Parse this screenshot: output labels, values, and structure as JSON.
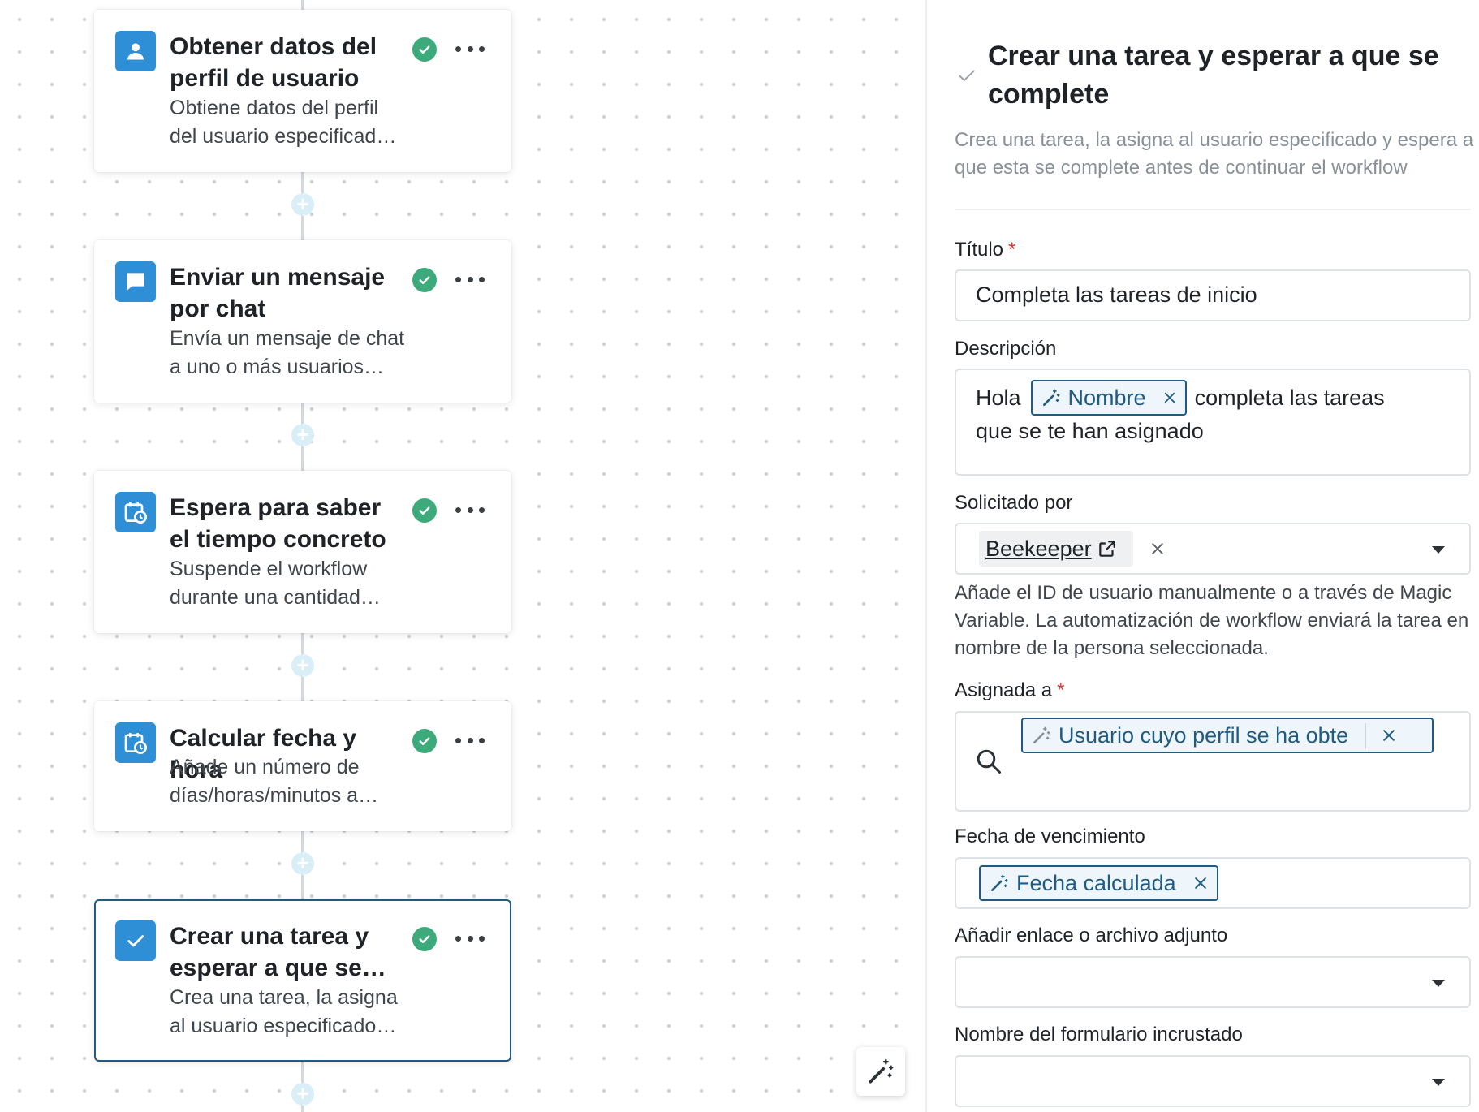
{
  "workflow": {
    "steps": [
      {
        "icon": "user-icon",
        "title": "Obtener datos del perfil de usuario",
        "description_line1": "Obtiene datos del perfil",
        "description_line2": "del usuario especificad…",
        "status": "completed"
      },
      {
        "icon": "chat-icon",
        "title": "Enviar un mensaje por chat",
        "description_line1": "Envía un mensaje de chat",
        "description_line2": "a uno o más usuarios…",
        "status": "completed"
      },
      {
        "icon": "calendar-clock-icon",
        "title": "Espera para saber el tiempo concreto",
        "description_line1": "Suspende el workflow",
        "description_line2": "durante una cantidad…",
        "status": "completed"
      },
      {
        "icon": "calendar-clock-icon",
        "title": "Calcular fecha y hora",
        "description_line1": "Añade un número de",
        "description_line2": "días/horas/minutos a…",
        "status": "completed"
      },
      {
        "icon": "task-check-icon",
        "title": "Crear una tarea y esperar a que se…",
        "description_line1": "Crea una tarea, la asigna",
        "description_line2": "al usuario especificado…",
        "status": "completed",
        "selected": true
      }
    ]
  },
  "panel": {
    "title": "Crear una tarea y esperar a que se complete",
    "description": "Crea una tarea, la asigna al usuario especificado y espera a que esta se complete antes de continuar el workflow",
    "fields": {
      "titulo": {
        "label": "Título",
        "required": "*",
        "value": "Completa las tareas de inicio"
      },
      "descripcion": {
        "label": "Descripción",
        "text_before": "Hola",
        "chip": "Nombre",
        "text_after_line1": "completa las tareas",
        "text_line2": "que se te han asignado"
      },
      "solicitado_por": {
        "label": "Solicitado por",
        "value": "Beekeeper",
        "help": "Añade el ID de usuario manualmente o a través de Magic Variable. La automatización de workflow enviará la tarea en nombre de la persona seleccionada."
      },
      "asignada_a": {
        "label": "Asignada a",
        "required": "*",
        "chip": "Usuario cuyo perfil se ha obte"
      },
      "fecha_vencimiento": {
        "label": "Fecha de vencimiento",
        "chip": "Fecha calculada"
      },
      "enlace_adjunto": {
        "label": "Añadir enlace o archivo adjunto",
        "value": ""
      },
      "formulario": {
        "label": "Nombre del formulario incrustado",
        "value": ""
      }
    }
  },
  "colors": {
    "accent": "#1f5b82",
    "step_icon_bg": "#2f8fd6",
    "success": "#3daa7c",
    "required": "#d23a3a"
  }
}
